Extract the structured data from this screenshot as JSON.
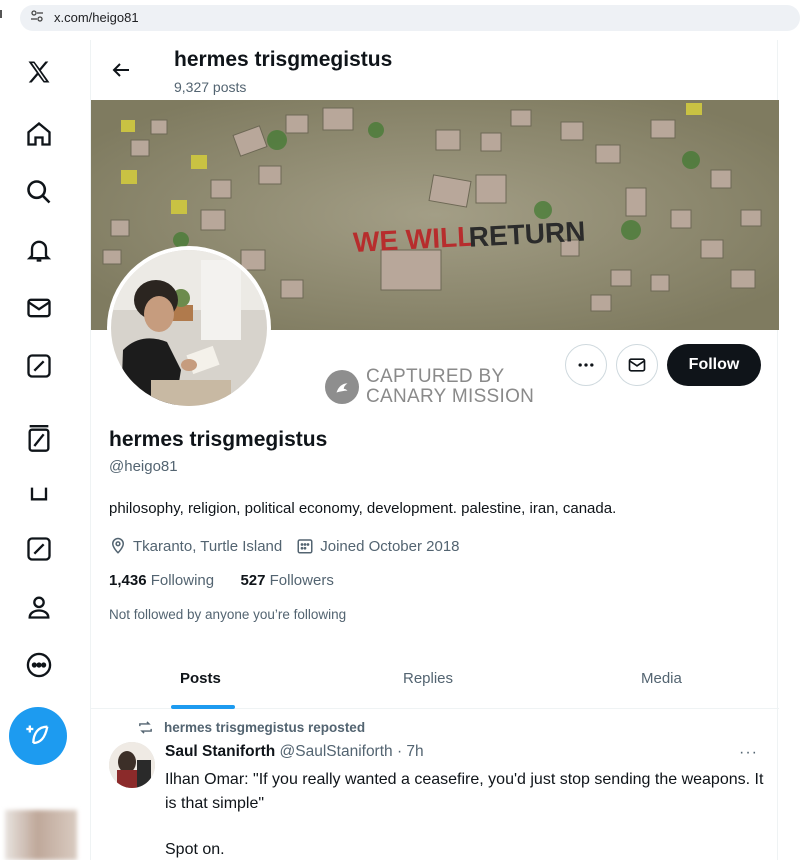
{
  "browser": {
    "url": "x.com/heigo81"
  },
  "nav": {
    "items": [
      "x-logo",
      "home",
      "explore",
      "notifications",
      "messages",
      "grok",
      "lists",
      "communities",
      "profile",
      "more"
    ]
  },
  "header": {
    "name": "hermes trisgmegistus",
    "posts": "9,327 posts"
  },
  "banner": {
    "graffiti": "WE WILL RETURN"
  },
  "watermark": {
    "line1": "CAPTURED BY",
    "line2": "CANARY MISSION"
  },
  "actions": {
    "follow_label": "Follow"
  },
  "profile": {
    "name": "hermes trisgmegistus",
    "handle": "@heigo81",
    "bio": "philosophy, religion, political economy, development. palestine, iran, canada.",
    "location": "Tkaranto, Turtle Island",
    "joined": "Joined October 2018",
    "following_count": "1,436",
    "following_label": "Following",
    "followers_count": "527",
    "followers_label": "Followers",
    "not_followed": "Not followed by anyone you’re following"
  },
  "tabs": [
    {
      "label": "Posts",
      "active": true
    },
    {
      "label": "Replies",
      "active": false
    },
    {
      "label": "Media",
      "active": false
    }
  ],
  "tweet": {
    "repost_label": "hermes trisgmegistus reposted",
    "author_name": "Saul Staniforth",
    "author_handle": "@SaulStaniforth",
    "time": "· 7h",
    "more": "···",
    "text_line1": "Ilhan Omar: \"If you really wanted a ceasefire, you'd just stop sending the weapons. It is that simple\"",
    "text_line2": "Spot on."
  },
  "colors": {
    "accent": "#1d9bf0",
    "text": "#0f1419",
    "muted": "#536471",
    "graffiti_red": "#c0392b"
  }
}
